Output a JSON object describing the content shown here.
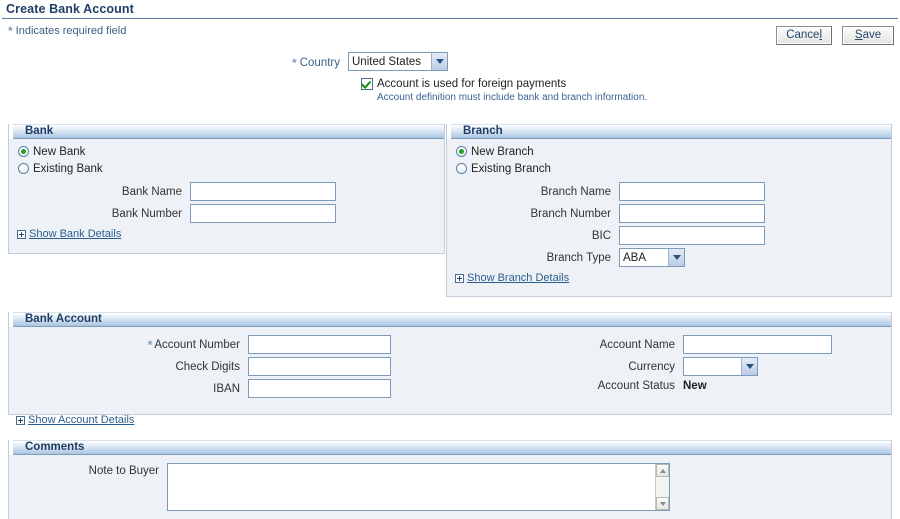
{
  "page": {
    "title": "Create Bank Account",
    "required_legend": "Indicates required field",
    "required_marker": "*"
  },
  "actions": {
    "cancel": {
      "pre": "Cance",
      "accel": "l",
      "post": ""
    },
    "save": {
      "pre": "",
      "accel": "S",
      "post": "ave"
    }
  },
  "country": {
    "label": "Country",
    "value": "United States"
  },
  "foreign": {
    "checkbox_label": "Account is used for foreign payments",
    "checked": true,
    "hint": "Account definition must include bank and branch information."
  },
  "bank": {
    "section_title": "Bank",
    "radios": [
      {
        "label": "New Bank",
        "selected": true
      },
      {
        "label": "Existing Bank",
        "selected": false
      }
    ],
    "fields": [
      {
        "label": "Bank Name",
        "value": "",
        "required": false
      },
      {
        "label": "Bank Number",
        "value": "",
        "required": false
      }
    ],
    "disclose_label": "Show Bank Details"
  },
  "branch": {
    "section_title": "Branch",
    "radios": [
      {
        "label": "New Branch",
        "selected": true
      },
      {
        "label": "Existing Branch",
        "selected": false
      }
    ],
    "fields": [
      {
        "label": "Branch Name",
        "value": ""
      },
      {
        "label": "Branch Number",
        "value": ""
      },
      {
        "label": "BIC",
        "value": ""
      }
    ],
    "branch_type": {
      "label": "Branch Type",
      "value": "ABA"
    },
    "disclose_label": "Show Branch Details"
  },
  "bank_account": {
    "section_title": "Bank Account",
    "left_fields": [
      {
        "label": "Account Number",
        "value": "",
        "required": true
      },
      {
        "label": "Check Digits",
        "value": "",
        "required": false
      },
      {
        "label": "IBAN",
        "value": "",
        "required": false
      }
    ],
    "account_name": {
      "label": "Account Name",
      "value": ""
    },
    "currency": {
      "label": "Currency",
      "value": ""
    },
    "account_status": {
      "label": "Account Status",
      "value": "New"
    },
    "disclose_label": "Show Account Details"
  },
  "comments": {
    "section_title": "Comments",
    "note_label": "Note to Buyer",
    "note_value": ""
  },
  "colors": {
    "title_blue": "#1f3f66",
    "link_blue": "#2a5d8f",
    "panel_bg": "#eef2f7",
    "header_blue": "#a9c6e2",
    "required_star": "#7a9ec4",
    "radio_dot_green": "#23a023",
    "check_green": "#178b17"
  }
}
